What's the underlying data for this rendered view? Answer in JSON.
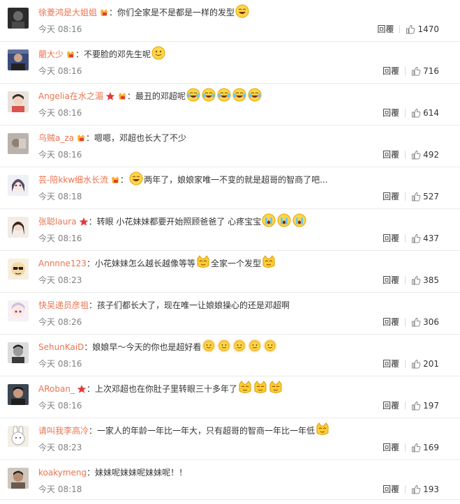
{
  "ui": {
    "reply_label": "回覆",
    "colon": "：",
    "accent": "#eb7350"
  },
  "comments": [
    {
      "user": "徐菱鸿是大姐姐",
      "badges": [
        "vip"
      ],
      "avatar": "dark",
      "parts": [
        {
          "t": "你们全家是不是都是一样的发型"
        },
        {
          "e": "laugh-emoji"
        }
      ],
      "time": "今天 08:16",
      "likes": "1470"
    },
    {
      "user": "藺大少",
      "badges": [
        "vip"
      ],
      "avatar": "photo",
      "parts": [
        {
          "t": "不要脸的邓先生呢"
        },
        {
          "e": "smile-emoji"
        }
      ],
      "time": "今天 08:16",
      "likes": "716"
    },
    {
      "user": "Angelia在水之湄",
      "badges": [
        "star",
        "vip"
      ],
      "avatar": "girl",
      "parts": [
        {
          "t": "最丑的邓超呢"
        },
        {
          "e": "laugh-cry-emoji"
        },
        {
          "e": "laugh-cry-emoji"
        },
        {
          "e": "laugh-cry-emoji"
        },
        {
          "e": "laugh-cry-emoji"
        },
        {
          "e": "laugh-cry-emoji"
        }
      ],
      "time": "今天 08:16",
      "likes": "614"
    },
    {
      "user": "乌贼a_za",
      "badges": [
        "vip"
      ],
      "avatar": "gray",
      "parts": [
        {
          "t": "嗯嗯，邓超也长大了不少"
        }
      ],
      "time": "今天 08:16",
      "likes": "492"
    },
    {
      "user": "芸-陪kkw细水长流",
      "badges": [
        "vip"
      ],
      "avatar": "anime",
      "parts": [
        {
          "e": "laugh-emoji"
        },
        {
          "t": "两年了，娘娘家唯一不变的就是超哥的智商了吧..."
        }
      ],
      "time": "今天 08:18",
      "likes": "527"
    },
    {
      "user": "张聪laura",
      "badges": [
        "star"
      ],
      "avatar": "girl2",
      "parts": [
        {
          "t": "转眼 小花妹妹都要开始照顾爸爸了 心疼宝宝"
        },
        {
          "e": "cry-emoji"
        },
        {
          "e": "cry-emoji"
        },
        {
          "e": "cry-emoji"
        }
      ],
      "time": "今天 08:16",
      "likes": "437"
    },
    {
      "user": "Annnne123",
      "badges": [],
      "avatar": "cartoon",
      "parts": [
        {
          "t": "小花妹妹怎么越长越像等等"
        },
        {
          "e": "cat-emoji"
        },
        {
          "t": "全家一个发型"
        },
        {
          "e": "cat-emoji"
        }
      ],
      "time": "今天 08:23",
      "likes": "385"
    },
    {
      "user": "快吴递员彦祖",
      "badges": [],
      "avatar": "chibi",
      "parts": [
        {
          "t": "孩子们都长大了，现在唯一让娘娘操心的还是邓超啊"
        }
      ],
      "time": "今天 08:26",
      "likes": "306"
    },
    {
      "user": "SehunKaiD",
      "badges": [],
      "avatar": "bw",
      "parts": [
        {
          "t": "娘娘早～今天的你也是超好看"
        },
        {
          "e": "sun-emoji"
        },
        {
          "e": "sun-emoji"
        },
        {
          "e": "sun-emoji"
        },
        {
          "e": "sun-emoji"
        },
        {
          "e": "sun-emoji"
        }
      ],
      "time": "今天 08:16",
      "likes": "201"
    },
    {
      "user": "ARoban_",
      "badges": [
        "star"
      ],
      "avatar": "man",
      "parts": [
        {
          "t": "上次邓超也在你肚子里转眼三十多年了"
        },
        {
          "e": "cat-emoji"
        },
        {
          "e": "cat-emoji"
        },
        {
          "e": "cat-emoji"
        }
      ],
      "time": "今天 08:16",
      "likes": "197"
    },
    {
      "user": "请叫我李高冷",
      "badges": [],
      "avatar": "bunny",
      "parts": [
        {
          "t": "一家人的年龄一年比一年大，只有超哥的智商一年比一年低"
        },
        {
          "e": "cat-emoji"
        }
      ],
      "time": "今天 08:23",
      "likes": "169"
    },
    {
      "user": "koakymeng",
      "badges": [],
      "avatar": "guy",
      "parts": [
        {
          "t": "妹妹呢妹妹呢妹妹呢！！"
        }
      ],
      "time": "今天 08:18",
      "likes": "193"
    }
  ]
}
